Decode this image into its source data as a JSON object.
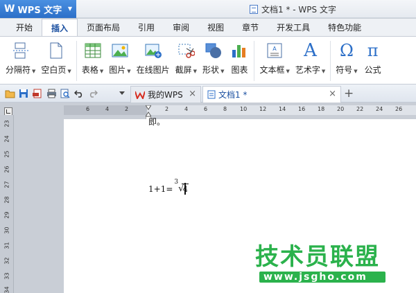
{
  "app": {
    "name": "WPS 文字",
    "logo": "W"
  },
  "window": {
    "title": "文档1 * - WPS 文字"
  },
  "menu_tabs": [
    "开始",
    "插入",
    "页面布局",
    "引用",
    "审阅",
    "视图",
    "章节",
    "开发工具",
    "特色功能"
  ],
  "active_tab": "插入",
  "ribbon": {
    "page_break": "分隔符",
    "blank_page": "空白页",
    "table": "表格",
    "picture": "图片",
    "online_picture": "在线图片",
    "screenshot": "截屏",
    "shape": "形状",
    "chart": "图表",
    "textbox": "文本框",
    "wordart": "艺术字",
    "symbol": "符号",
    "formula": "公式",
    "symbol_glyph": "Ω",
    "formula_glyph": "π",
    "wordart_glyph": "A"
  },
  "doc_tabs": {
    "my_wps": "我的WPS",
    "doc1": "文档1 *",
    "close": "×",
    "add": "+"
  },
  "ruler": {
    "h_ticks": [
      "6",
      "4",
      "2",
      "2",
      "4",
      "6",
      "8",
      "10",
      "12",
      "14",
      "16",
      "18",
      "20",
      "22",
      "24",
      "26"
    ],
    "v_ticks": [
      "23",
      "24",
      "25",
      "26",
      "27",
      "28",
      "29",
      "30",
      "31",
      "32",
      "33",
      "34"
    ]
  },
  "document": {
    "prev_line": "即。",
    "equation_lhs": "1+1=",
    "root_index": "3",
    "radicand": "4"
  },
  "watermark": {
    "brand": "技术员联盟",
    "url": "www.jsgho.com"
  },
  "colors": {
    "accent": "#2c6fc8",
    "watermark_green": "#2bb24c"
  }
}
